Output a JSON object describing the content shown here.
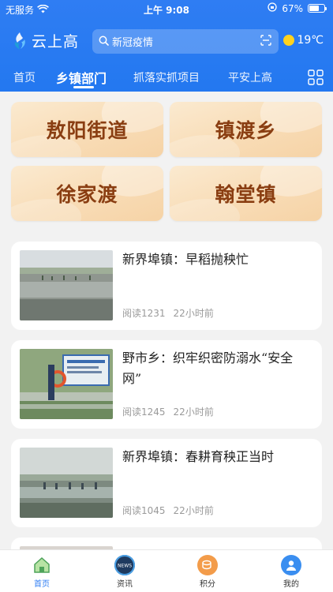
{
  "status": {
    "carrier": "无服务",
    "time": "上午 9:08",
    "battery": "67%",
    "battery_level": 0.67
  },
  "header": {
    "app_name": "云上高",
    "search_placeholder": "新冠疫情",
    "weather_temp": "19℃"
  },
  "nav": {
    "items": [
      "首页",
      "乡镇部门",
      "抓落实抓项目",
      "平安上高"
    ],
    "active_index": 1
  },
  "towns": [
    "敖阳街道",
    "镇渡乡",
    "徐家渡",
    "翰堂镇"
  ],
  "news": [
    {
      "title": "新界埠镇：早稻抛秧忙",
      "reads": "阅读1231",
      "time": "22小时前"
    },
    {
      "title": "野市乡：织牢织密防溺水“安全网”",
      "reads": "阅读1245",
      "time": "22小时前"
    },
    {
      "title": "新界埠镇：春耕育秧正当时",
      "reads": "阅读1045",
      "time": "22小时前"
    }
  ],
  "tabbar": {
    "items": [
      "首页",
      "资讯",
      "积分",
      "我的"
    ],
    "active_index": 0
  },
  "colors": {
    "primary": "#2f7df3",
    "town_text": "#8a3e12",
    "town_bg": "#f8dcb6",
    "weather_sun": "#ffd21f"
  }
}
